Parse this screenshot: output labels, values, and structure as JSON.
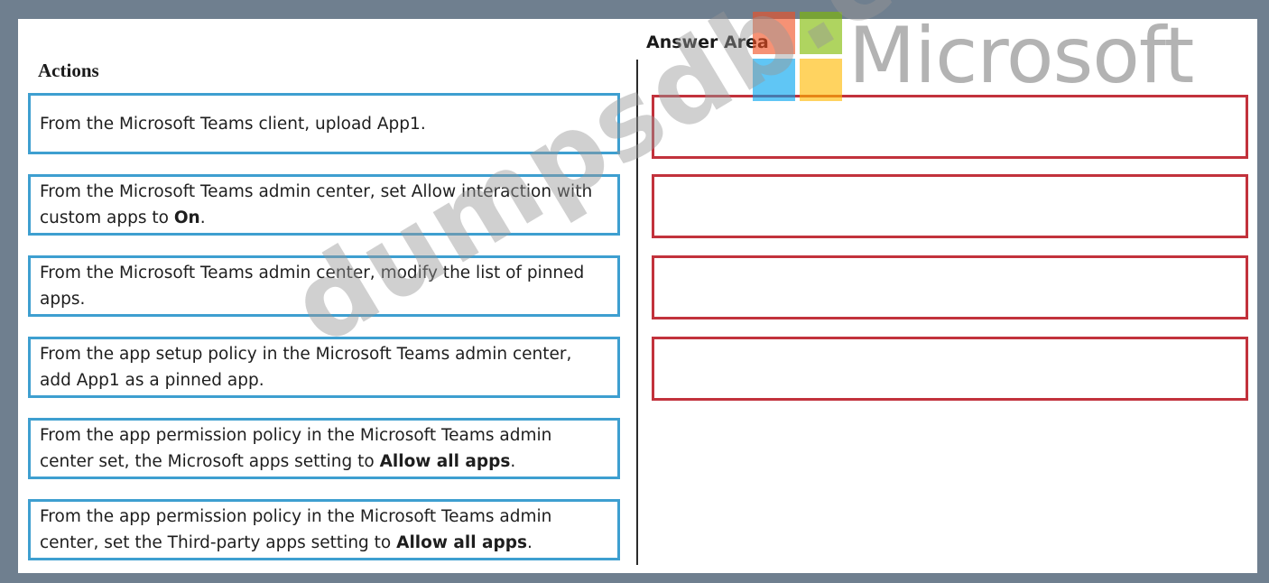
{
  "actions": {
    "title": "Actions",
    "items": [
      {
        "text": "From the Microsoft Teams client, upload App1.",
        "bold": "",
        "end": ""
      },
      {
        "text": "From the Microsoft Teams admin center, set Allow interaction with custom apps to ",
        "bold": "On",
        "end": "."
      },
      {
        "text": "From the Microsoft Teams admin center, modify the list of pinned apps.",
        "bold": "",
        "end": ""
      },
      {
        "text": "From the app setup policy in the Microsoft Teams admin center, add App1 as a pinned app.",
        "bold": "",
        "end": ""
      },
      {
        "text": "From the app permission policy in the Microsoft Teams admin center set, the Microsoft apps setting to ",
        "bold": "Allow all apps",
        "end": "."
      },
      {
        "text": "From the app permission policy in the Microsoft Teams admin center, set the Third-party apps setting to ",
        "bold": "Allow all apps",
        "end": "."
      }
    ]
  },
  "answer": {
    "title": "Answer Area",
    "slots": [
      "",
      "",
      "",
      ""
    ]
  },
  "watermark": {
    "brand": "Microsoft",
    "logo_colors": [
      "#f25022",
      "#7fba00",
      "#00a4ef",
      "#ffb900"
    ],
    "site": "dumpsdb.com"
  }
}
